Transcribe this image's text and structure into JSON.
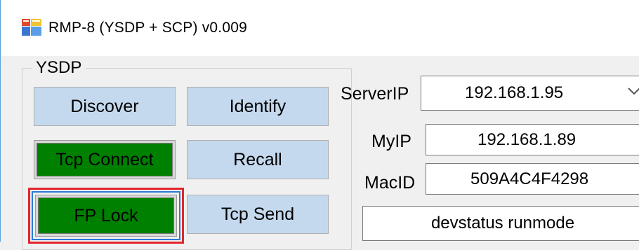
{
  "window": {
    "title": "RMP-8 (YSDP + SCP) v0.009",
    "icon": "app-window-icon"
  },
  "ysdp_group": {
    "label": "YSDP",
    "buttons": {
      "discover": "Discover",
      "identify": "Identify",
      "tcp_connect": "Tcp Connect",
      "recall": "Recall",
      "fp_lock": "FP Lock",
      "tcp_send": "Tcp Send"
    }
  },
  "network": {
    "server_ip_label": "ServerIP",
    "server_ip_value": "192.168.1.95",
    "my_ip_label": "MyIP",
    "my_ip_value": "192.168.1.89",
    "mac_id_label": "MacID",
    "mac_id_value": "509A4C4F4298",
    "status_text": "devstatus runmode"
  },
  "colors": {
    "button_blue": "#c5d9ee",
    "button_green": "#008000",
    "highlight_red": "#e0262d",
    "focus_blue": "#2a7bd8"
  }
}
